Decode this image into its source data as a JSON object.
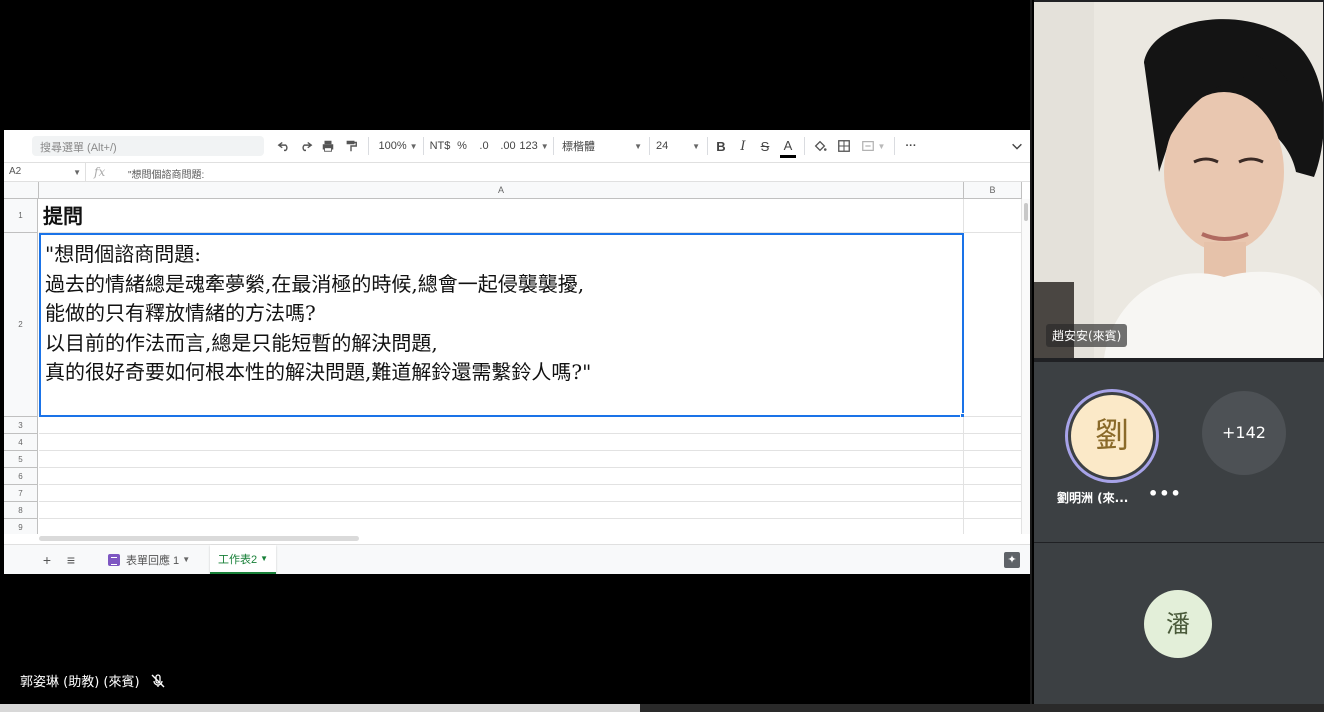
{
  "toolbar": {
    "menu_search_placeholder": "搜尋選單 (Alt+/)",
    "zoom": "100%",
    "currency": "NT$",
    "percent": "%",
    "decrease_decimal": ".0",
    "increase_decimal": ".00",
    "format_more": "123",
    "font": "標楷體",
    "font_size": "24",
    "bold": "B",
    "italic": "I",
    "strike": "S",
    "text_color": "A"
  },
  "formula_bar": {
    "cell_ref": "A2",
    "fx": "fx",
    "value": "\"想問個諮商問題:"
  },
  "grid": {
    "col_a": "A",
    "col_b": "B",
    "rows": [
      "1",
      "2",
      "3",
      "4",
      "5",
      "6",
      "7",
      "8",
      "9"
    ],
    "a1": "提問",
    "a2": "\"想問個諮商問題:\n過去的情緒總是魂牽夢縈,在最消極的時候,總會一起侵襲襲擾,\n能做的只有釋放情緒的方法嗎?\n以目前的作法而言,總是只能短暫的解決問題,\n真的很好奇要如何根本性的解決問題,難道解鈴還需繫鈴人嗎?\""
  },
  "tabs": {
    "add": "+",
    "list": "≡",
    "sheet1": "表單回應 1",
    "sheet2": "工作表2"
  },
  "presenter": {
    "name": "郭姿琳 (助教) (來賓)"
  },
  "participants": {
    "video_name": "趙安安(來賓)",
    "avatar1_char": "劉",
    "avatar1_name": "劉明洲 (來...",
    "more_count": "+142",
    "avatar2_char": "潘",
    "more_dots": "•••"
  }
}
